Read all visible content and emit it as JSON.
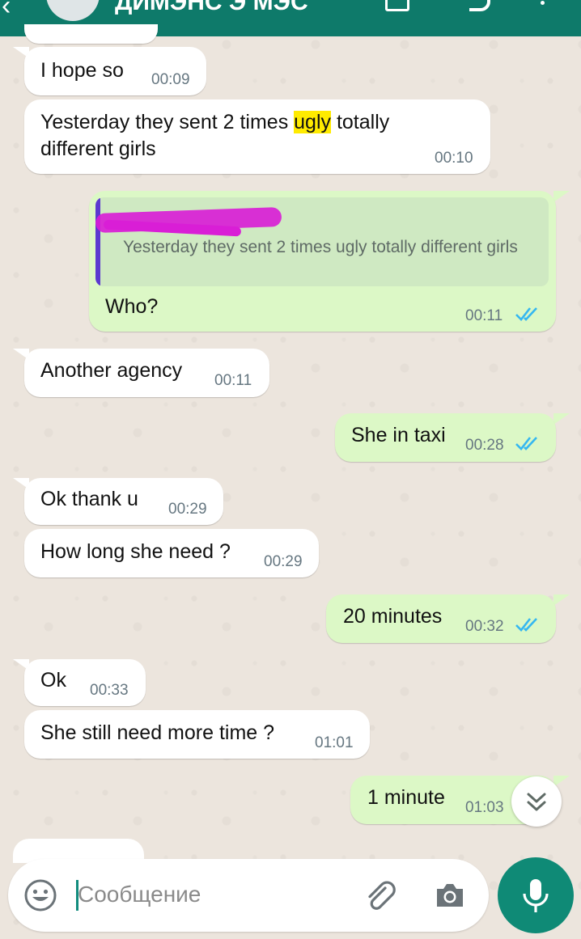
{
  "header": {
    "title": "ДИМЭНС Э МЭС",
    "colors": {
      "bar": "#0e7a6a"
    }
  },
  "messages": [
    {
      "dir": "in",
      "text": "I hope so",
      "time": "00:09"
    },
    {
      "dir": "in",
      "text_before": "Yesterday they sent 2 times ",
      "highlight": "ugly",
      "text_after": " totally",
      "text_line2": "different girls",
      "time": "00:10"
    },
    {
      "dir": "out",
      "quote_text": "Yesterday they sent 2 times ugly totally different girls",
      "text": "Who?",
      "time": "00:11"
    },
    {
      "dir": "in",
      "text": "Another agency",
      "time": "00:11"
    },
    {
      "dir": "out",
      "text": "She in taxi",
      "time": "00:28"
    },
    {
      "dir": "in",
      "text": "Ok thank u",
      "time": "00:29"
    },
    {
      "dir": "in",
      "text": "How long she need ?",
      "time": "00:29"
    },
    {
      "dir": "out",
      "text": "20 minutes",
      "time": "00:32"
    },
    {
      "dir": "in",
      "text": "Ok",
      "time": "00:33"
    },
    {
      "dir": "in",
      "text": "She still need more time ?",
      "time": "01:01"
    },
    {
      "dir": "out",
      "text": "1 minute",
      "time": "01:03"
    }
  ],
  "composer": {
    "placeholder": "Сообщение"
  },
  "icons": {
    "emoji": "emoji-icon",
    "attach": "paperclip-icon",
    "camera": "camera-icon",
    "mic": "microphone-icon",
    "scroll": "chevron-double-down-icon",
    "read": "double-check-icon"
  },
  "colors": {
    "incoming": "#ffffff",
    "outgoing": "#dcf8c6",
    "tick": "#34b7f1",
    "accent": "#0f8a76",
    "highlight": "#ffeb00"
  }
}
